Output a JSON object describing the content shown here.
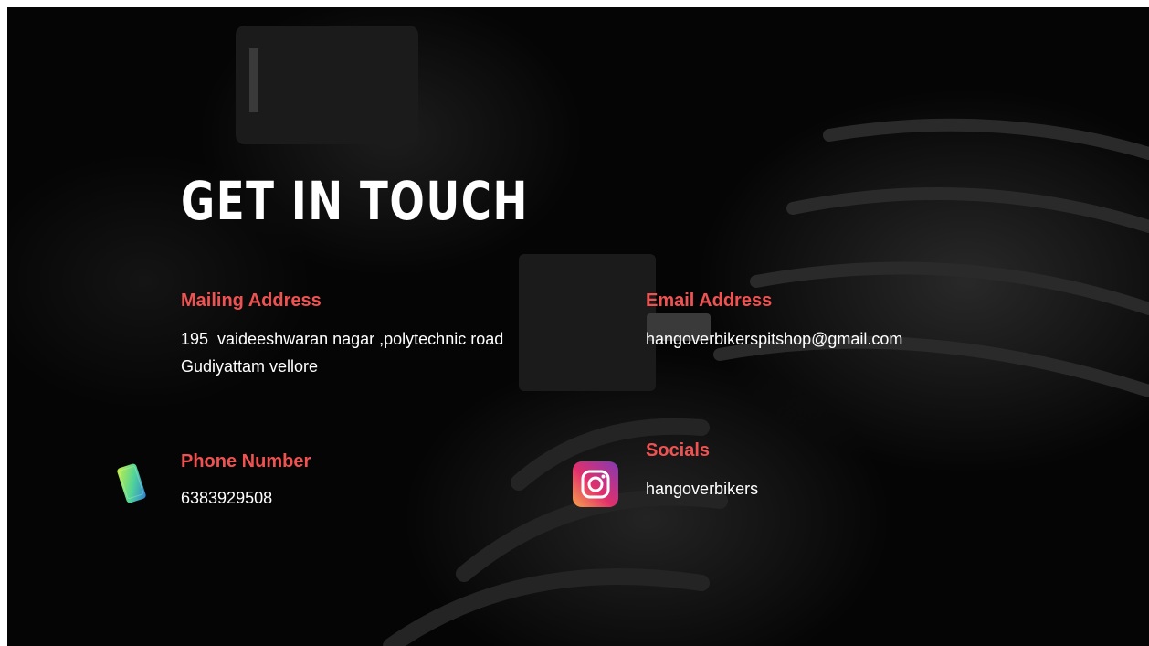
{
  "page": {
    "title": "GET IN TOUCH"
  },
  "mailing": {
    "label": "Mailing Address",
    "line1": "195  vaideeshwaran nagar ,polytechnic road",
    "line2": "Gudiyattam vellore"
  },
  "email": {
    "label": "Email Address",
    "value": "hangoverbikerspitshop@gmail.com"
  },
  "phone": {
    "label": "Phone Number",
    "value": "6383929508",
    "icon": "phone-icon"
  },
  "socials": {
    "label": "Socials",
    "value": "hangoverbikers",
    "icon": "instagram-icon"
  },
  "colors": {
    "background": "#050505",
    "label": "#f05252",
    "text": "#ffffff"
  }
}
